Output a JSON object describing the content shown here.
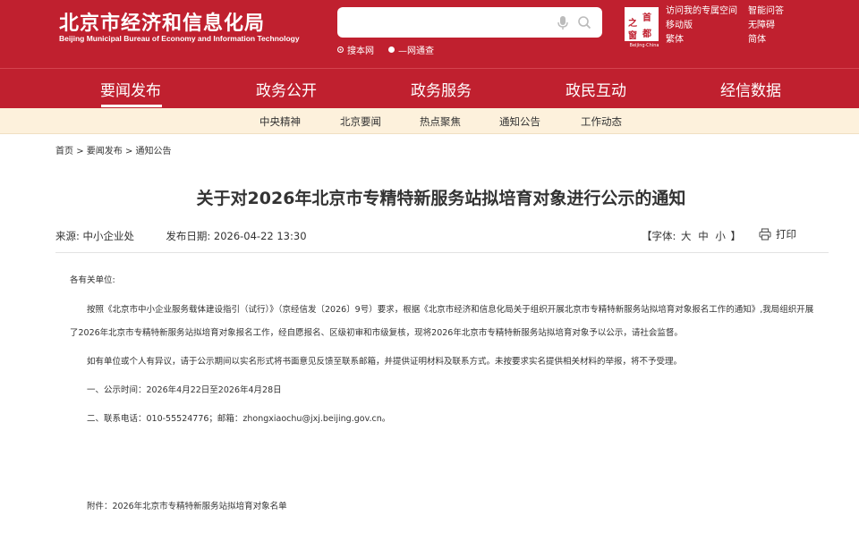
{
  "header": {
    "site_title": "北京市经济和信息化局",
    "site_subtitle": "Beijing Municipal Bureau of Economy and Information Technology",
    "search": {
      "placeholder": "",
      "icons": [
        "microphone-icon",
        "search-icon"
      ]
    },
    "scope_options": [
      {
        "label": "搜本网",
        "checked": true
      },
      {
        "label": "—网通查",
        "checked": false
      }
    ],
    "capital_logo": {
      "chars": [
        "首",
        "都",
        "之",
        "窗"
      ],
      "tag": "Beijing·China"
    },
    "top_links": [
      "访问我的专属空间",
      "智能问答",
      "移动版",
      "无障碍",
      "繁体",
      "简体"
    ]
  },
  "main_nav": {
    "items": [
      "要闻发布",
      "政务公开",
      "政务服务",
      "政民互动",
      "经信数据"
    ],
    "active": "要闻发布"
  },
  "sub_nav": {
    "items": [
      "中央精神",
      "北京要闻",
      "热点聚焦",
      "通知公告",
      "工作动态"
    ]
  },
  "breadcrumb": {
    "items": [
      "首页",
      "要闻发布",
      "通知公告"
    ],
    "separator": ">"
  },
  "article": {
    "title": "关于对2026年北京市专精特新服务站拟培育对象进行公示的通知",
    "source_label": "来源:",
    "source": "中小企业处",
    "date_label": "发布日期:",
    "date": "2026-04-22 13:30",
    "font_size_label": "【字体:",
    "font_sizes": [
      "大",
      "中",
      "小"
    ],
    "font_size_close": "】",
    "print_label": "打印",
    "salutation": "各有关单位:",
    "paragraph1": "按照《北京市中小企业服务载体建设指引（试行）》（京经信发〔2026〕9号）要求，根据《北京市经济和信息化局关于组织开展北京市专精特新服务站拟培育对象报名工作的通知》,我局组织开展了2026年北京市专精特新服务站拟培育对象报名工作，经自愿报名、区级初审和市级复核，现将2026年北京市专精特新服务站拟培育对象予以公示，请社会监督。",
    "paragraph2": "如有单位或个人有异议，请于公示期间以实名形式将书面意见反馈至联系邮箱，并提供证明材料及联系方式。未按要求实名提供相关材料的举报，将不予受理。",
    "item1": "一、公示时间：2026年4月22日至2026年4月28日",
    "item2": "二、联系电话：010-55524776；邮箱：zhongxiaochu@jxj.beijing.gov.cn。",
    "attachment": "附件：2026年北京市专精特新服务站拟培育对象名单"
  },
  "colors": {
    "brand_red": "#c0202f",
    "subnav_bg": "#fdf1dc"
  }
}
